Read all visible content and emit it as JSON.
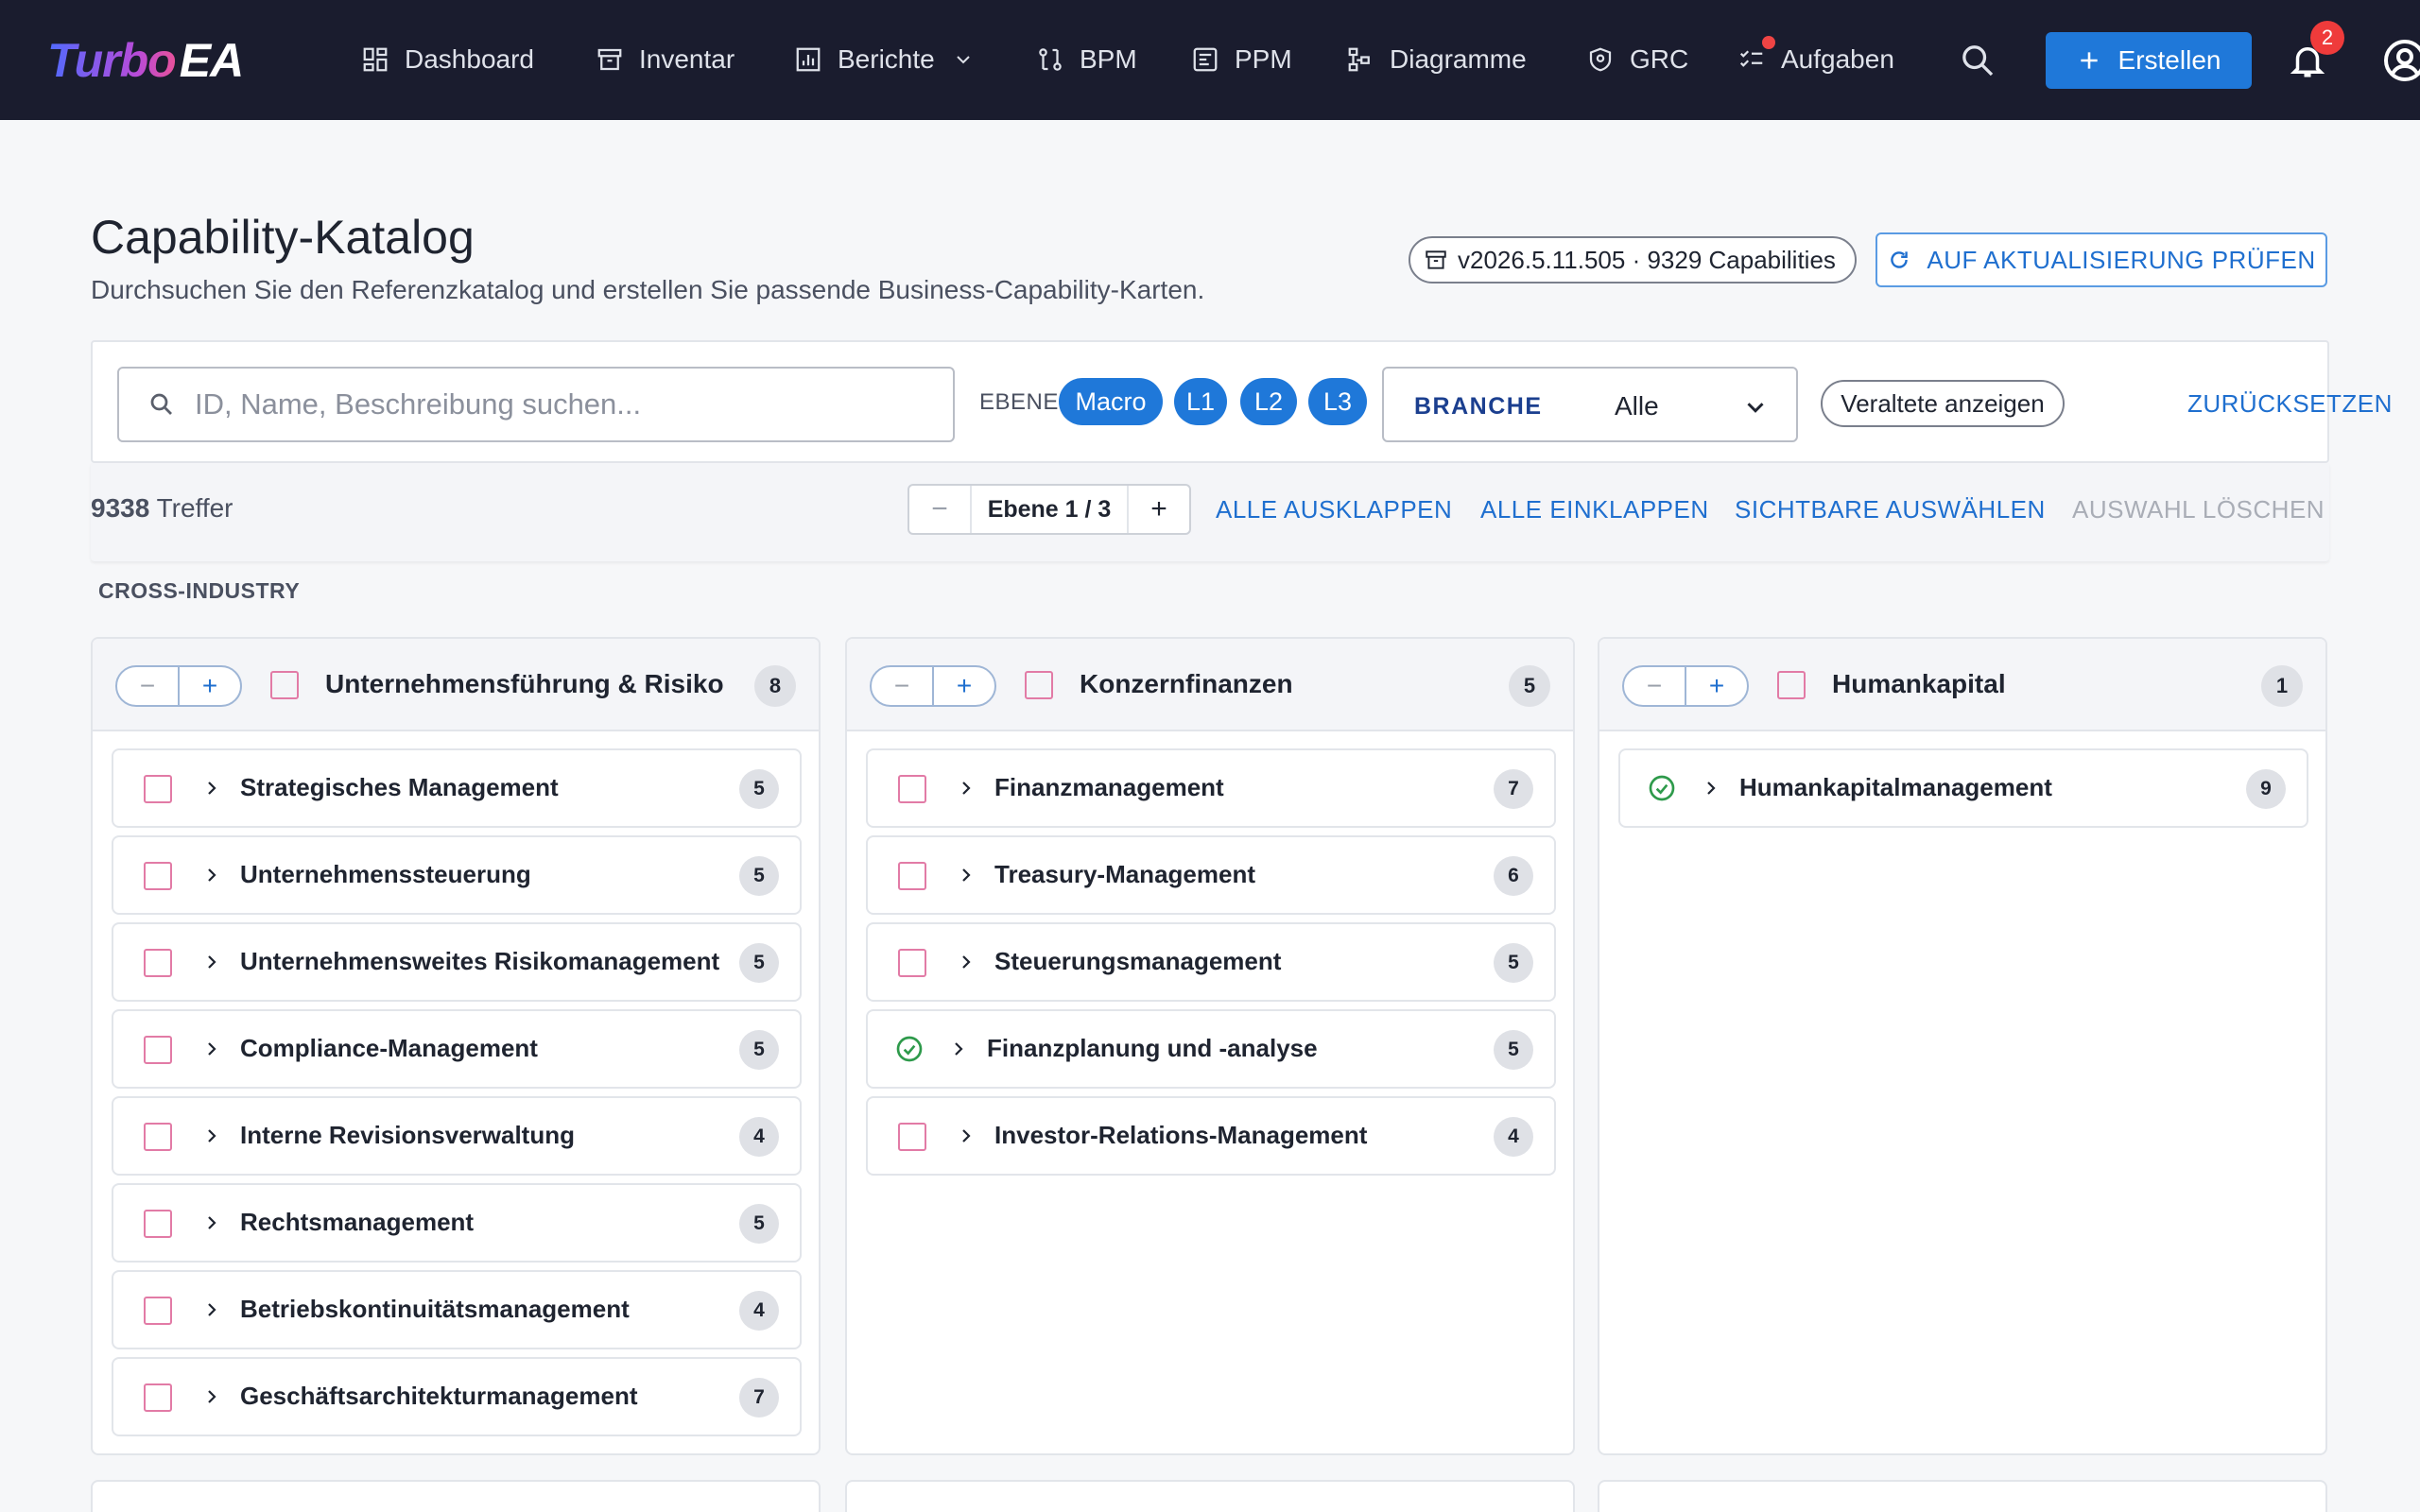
{
  "nav": {
    "logo_turbo": "Turbo",
    "logo_ea": "EA",
    "dashboard": "Dashboard",
    "inventar": "Inventar",
    "berichte": "Berichte",
    "bpm": "BPM",
    "ppm": "PPM",
    "diagramme": "Diagramme",
    "grc": "GRC",
    "aufgaben": "Aufgaben",
    "erstellen": "Erstellen",
    "notification_count": "2"
  },
  "header": {
    "title": "Capability-Katalog",
    "subtitle": "Durchsuchen Sie den Referenzkatalog und erstellen Sie passende Business-Capability-Karten.",
    "version": "v2026.5.11.505 · 9329 Capabilities",
    "check_update": "AUF AKTUALISIERUNG PRÜFEN"
  },
  "filters": {
    "search_placeholder": "ID, Name, Beschreibung suchen...",
    "search_value": "",
    "level_label": "EBENE",
    "levels": [
      "Macro",
      "L1",
      "L2",
      "L3"
    ],
    "branche_label": "BRANCHE",
    "branche_value": "Alle",
    "show_obsolete": "Veraltete anzeigen",
    "reset": "ZURÜCKSETZEN"
  },
  "results": {
    "count": "9338",
    "count_label": "Treffer",
    "level_indicator": "Ebene 1 / 3",
    "expand_all": "ALLE AUSKLAPPEN",
    "collapse_all": "ALLE EINKLAPPEN",
    "select_visible": "SICHTBARE AUSWÄHLEN",
    "clear_selection": "AUSWAHL LÖSCHEN"
  },
  "section": "CROSS-INDUSTRY",
  "columns": [
    {
      "name": "Unternehmensführung & Risiko",
      "count": "8",
      "items": [
        {
          "label": "Strategisches Management",
          "count": "5",
          "done": false
        },
        {
          "label": "Unternehmenssteuerung",
          "count": "5",
          "done": false
        },
        {
          "label": "Unternehmensweites Risikomanagement",
          "count": "5",
          "done": false
        },
        {
          "label": "Compliance-Management",
          "count": "5",
          "done": false
        },
        {
          "label": "Interne Revisionsverwaltung",
          "count": "4",
          "done": false
        },
        {
          "label": "Rechtsmanagement",
          "count": "5",
          "done": false
        },
        {
          "label": "Betriebskontinuitätsmanagement",
          "count": "4",
          "done": false
        },
        {
          "label": "Geschäftsarchitekturmanagement",
          "count": "7",
          "done": false
        }
      ]
    },
    {
      "name": "Konzernfinanzen",
      "count": "5",
      "items": [
        {
          "label": "Finanzmanagement",
          "count": "7",
          "done": false
        },
        {
          "label": "Treasury-Management",
          "count": "6",
          "done": false
        },
        {
          "label": "Steuerungsmanagement",
          "count": "5",
          "done": false
        },
        {
          "label": "Finanzplanung und -analyse",
          "count": "5",
          "done": true
        },
        {
          "label": "Investor-Relations-Management",
          "count": "4",
          "done": false
        }
      ]
    },
    {
      "name": "Humankapital",
      "count": "1",
      "items": [
        {
          "label": "Humankapitalmanagement",
          "count": "9",
          "done": true
        }
      ]
    }
  ],
  "colors": {
    "nav_bg": "#1a1c2e",
    "accent": "#1f78d9",
    "link": "#1f6fcf",
    "checkbox": "#e27ba6",
    "success": "#2e9a4b",
    "badge": "#ef3b3b"
  },
  "icons": {
    "dashboard": "dashboard-icon",
    "inventar": "archive-icon",
    "berichte": "chart-icon",
    "bpm": "process-icon",
    "ppm": "project-icon",
    "diagramme": "diagram-icon",
    "grc": "shield-icon",
    "aufgaben": "tasks-icon",
    "search": "search-icon",
    "notifications": "bell-icon",
    "account": "account-icon",
    "refresh": "refresh-icon"
  }
}
